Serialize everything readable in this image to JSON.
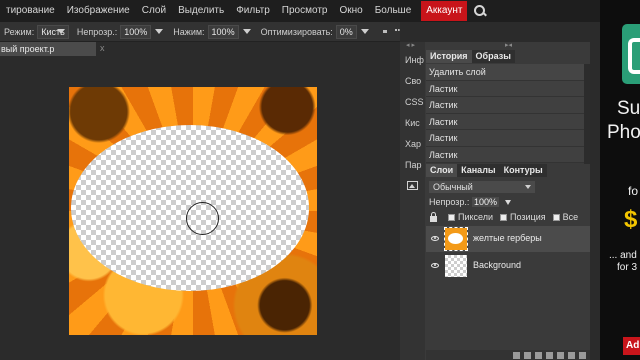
{
  "menu": {
    "items": [
      "тирование",
      "Изображение",
      "Слой",
      "Выделить",
      "Фильтр",
      "Просмотр",
      "Окно",
      "Больше"
    ],
    "account_label": "Аккаунт",
    "search_icon": "search-icon"
  },
  "options": {
    "mode_label": "Режим:",
    "mode_value": "Кисть",
    "opacity_label": "Непрозр.:",
    "opacity_value": "100%",
    "pressure_label": "Нажим:",
    "pressure_value": "100%",
    "optimize_label": "Оптимизировать:",
    "optimize_value": "0%"
  },
  "document": {
    "tab_title": "вый проект.p",
    "close_glyph": "x"
  },
  "side_tabs": {
    "collapse_left": "◂ ▸",
    "items": [
      "Инф",
      "Сво",
      "CSS",
      "Кис",
      "Хар",
      "Пар"
    ]
  },
  "history_panel": {
    "collapse": "▸◂",
    "tabs": [
      "История",
      "Образы"
    ],
    "items": [
      "Удалить слой",
      "Ластик",
      "Ластик",
      "Ластик",
      "Ластик",
      "Ластик"
    ]
  },
  "layers_panel": {
    "tabs": [
      "Слои",
      "Каналы",
      "Контуры"
    ],
    "blend_mode": "Обычный",
    "opacity_label": "Непрозр.:",
    "opacity_value": "100%",
    "lock_labels": [
      "Пиксели",
      "Позиция",
      "Все"
    ],
    "layers": [
      {
        "name": "желтые герберы",
        "selected": true
      },
      {
        "name": "Background",
        "selected": false
      }
    ]
  },
  "ad": {
    "line1": "Su",
    "line2": "Pho",
    "line3": "fo",
    "line4": "$",
    "line5": "... and",
    "line6": "for 3",
    "button": "Ad"
  }
}
